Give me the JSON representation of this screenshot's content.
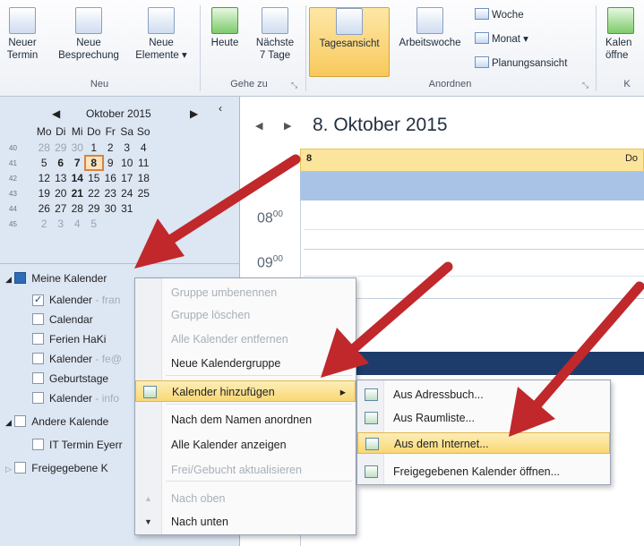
{
  "ribbon": {
    "buttons": {
      "new_appointment": "Neuer\nTermin",
      "new_meeting": "Neue\nBesprechung",
      "new_items": "Neue\nElemente ▾",
      "today": "Heute",
      "next7": "Nächste\n7 Tage",
      "day_view": "Tagesansicht",
      "work_week": "Arbeitswoche",
      "week": "Woche",
      "month": "Monat ▾",
      "schedule_view": "Planungsansicht",
      "open_calendar": "Kalen\nöffne"
    },
    "groups": {
      "new": "Neu",
      "goto": "Gehe zu",
      "arrange": "Anordnen",
      "manage": "K"
    }
  },
  "mini_calendar": {
    "month_label": "Oktober 2015",
    "weekdays": [
      "Mo",
      "Di",
      "Mi",
      "Do",
      "Fr",
      "Sa",
      "So"
    ],
    "weeks": [
      {
        "wk": "40",
        "days": [
          "28",
          "29",
          "30",
          "1",
          "2",
          "3",
          "4"
        ]
      },
      {
        "wk": "41",
        "days": [
          "5",
          "6",
          "7",
          "8",
          "9",
          "10",
          "11"
        ]
      },
      {
        "wk": "42",
        "days": [
          "12",
          "13",
          "14",
          "15",
          "16",
          "17",
          "18"
        ]
      },
      {
        "wk": "43",
        "days": [
          "19",
          "20",
          "21",
          "22",
          "23",
          "24",
          "25"
        ]
      },
      {
        "wk": "44",
        "days": [
          "26",
          "27",
          "28",
          "29",
          "30",
          "31",
          ""
        ]
      },
      {
        "wk": "45",
        "days": [
          "2",
          "3",
          "4",
          "5",
          "",
          "",
          ""
        ]
      }
    ]
  },
  "tree": {
    "my_calendars": "Meine Kalender",
    "items": [
      {
        "label": "Kalender",
        "suffix": " - fran",
        "checked": true
      },
      {
        "label": "Calendar",
        "suffix": "",
        "checked": false
      },
      {
        "label": "Ferien HaKi",
        "suffix": "",
        "checked": false
      },
      {
        "label": "Kalender",
        "suffix": " - fe@",
        "checked": false
      },
      {
        "label": "Geburtstage",
        "suffix": "",
        "checked": false
      },
      {
        "label": "Kalender",
        "suffix": " - info",
        "checked": false
      }
    ],
    "other_calendars": "Andere Kalende",
    "other_item": "IT Termin Eyerr",
    "shared": "Freigegebene K"
  },
  "main": {
    "date_title": "8. Oktober 2015",
    "day_header": "8",
    "day_header_right": "Do",
    "hours": [
      "08",
      "09"
    ],
    "minutes": "00"
  },
  "context_menu": [
    {
      "label": "Gruppe umbenennen",
      "disabled": true
    },
    {
      "label": "Gruppe löschen",
      "disabled": true
    },
    {
      "label": "Alle Kalender entfernen",
      "disabled": true
    },
    {
      "label": "Neue Kalendergruppe",
      "disabled": false
    },
    {
      "label": "Kalender hinzufügen",
      "disabled": false,
      "submenu": true
    },
    {
      "label": "Nach dem Namen anordnen",
      "disabled": false
    },
    {
      "label": "Alle Kalender anzeigen",
      "disabled": false
    },
    {
      "label": "Frei/Gebucht aktualisieren",
      "disabled": true
    },
    {
      "label": "Nach oben",
      "disabled": true
    },
    {
      "label": "Nach unten",
      "disabled": false
    }
  ],
  "submenu": [
    {
      "label": "Aus Adressbuch..."
    },
    {
      "label": "Aus Raumliste..."
    },
    {
      "label": "Aus dem Internet..."
    },
    {
      "label": "Freigegebenen Kalender öffnen..."
    }
  ],
  "colors": {
    "accent_red": "#c0282b",
    "highlight": "#f9d774",
    "dark_band": "#1d3c6b"
  }
}
